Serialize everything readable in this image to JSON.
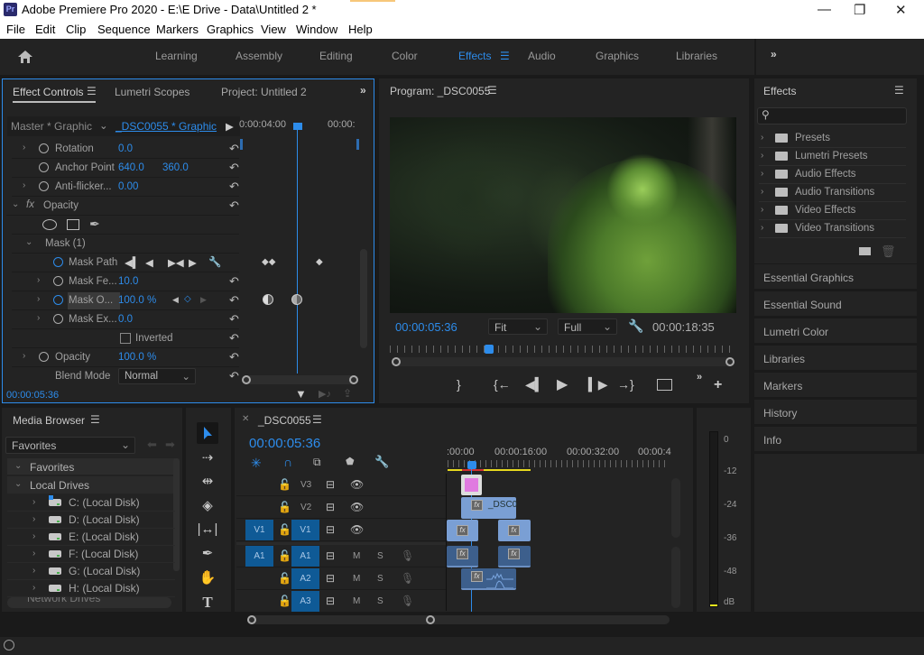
{
  "window": {
    "app_badge": "Pr",
    "title": "Adobe Premiere Pro 2020 - E:\\E Drive - Data\\Untitled 2 *",
    "controls": {
      "minimize": "—",
      "restore": "❐",
      "close": "✕"
    }
  },
  "menu": [
    "File",
    "Edit",
    "Clip",
    "Sequence",
    "Markers",
    "Graphics",
    "View",
    "Window",
    "Help"
  ],
  "workspaces": {
    "items": [
      "Learning",
      "Assembly",
      "Editing",
      "Color",
      "Effects",
      "Audio",
      "Graphics",
      "Libraries"
    ],
    "active": "Effects",
    "overflow": "»"
  },
  "effect_controls": {
    "tabs": [
      "Effect Controls",
      "Lumetri Scopes",
      "Project: Untitled 2"
    ],
    "active_tab": "Effect Controls",
    "master_label": "Master * Graphic",
    "clip_label": "_DSC0055 * Graphic",
    "ruler_start": "0:00:04:00",
    "ruler_end": "00:00:",
    "properties": {
      "rotation": {
        "label": "Rotation",
        "value": "0.0"
      },
      "anchor_point": {
        "label": "Anchor Point",
        "x": "640.0",
        "y": "360.0"
      },
      "anti_flicker": {
        "label": "Anti-flicker...",
        "value": "0.00"
      },
      "opacity_group": {
        "label": "Opacity",
        "fx": "fx"
      },
      "mask": {
        "label": "Mask (1)"
      },
      "mask_path": {
        "label": "Mask Path"
      },
      "mask_feather": {
        "label": "Mask Fe...",
        "value": "10.0"
      },
      "mask_opacity": {
        "label": "Mask O...",
        "value": "100.0 %"
      },
      "mask_expansion": {
        "label": "Mask Ex...",
        "value": "0.0"
      },
      "inverted": {
        "label": "Inverted",
        "checked": false
      },
      "opacity": {
        "label": "Opacity",
        "value": "100.0 %"
      },
      "blend_mode": {
        "label": "Blend Mode",
        "value": "Normal"
      }
    },
    "timecode": "00:00:05:36"
  },
  "program_monitor": {
    "title": "Program: _DSC0055",
    "timecode": "00:00:05:36",
    "zoom": "Fit",
    "resolution": "Full",
    "duration": "00:00:18:35",
    "playhead_fraction": 0.29
  },
  "effects_panel": {
    "title": "Effects",
    "search_placeholder": "",
    "items": [
      "Presets",
      "Lumetri Presets",
      "Audio Effects",
      "Audio Transitions",
      "Video Effects",
      "Video Transitions"
    ]
  },
  "side_panels": [
    "Essential Graphics",
    "Essential Sound",
    "Lumetri Color",
    "Libraries",
    "Markers",
    "History",
    "Info"
  ],
  "media_browser": {
    "title": "Media Browser",
    "location": "Favorites",
    "groups": [
      "Favorites",
      "Local Drives"
    ],
    "drives": [
      "C: (Local Disk)",
      "D: (Local Disk)",
      "E: (Local Disk)",
      "F: (Local Disk)",
      "G: (Local Disk)",
      "H: (Local Disk)"
    ],
    "partial": "Network Drives"
  },
  "timeline": {
    "sequence": "_DSC0055",
    "timecode": "00:00:05:36",
    "ruler": [
      ":00:00",
      "00:00:16:00",
      "00:00:32:00",
      "00:00:4"
    ],
    "video_tracks": [
      {
        "name": "V3",
        "source": ""
      },
      {
        "name": "V2",
        "source": ""
      },
      {
        "name": "V1",
        "source": "V1"
      }
    ],
    "audio_tracks": [
      {
        "name": "A1",
        "source": "A1",
        "m": "M",
        "s": "S"
      },
      {
        "name": "A2",
        "source": "",
        "m": "M",
        "s": "S"
      },
      {
        "name": "A3",
        "source": "",
        "m": "M",
        "s": "S"
      }
    ],
    "clip_label": "_DSC0"
  },
  "audio_meter": {
    "ticks": [
      "0",
      "-12",
      "-24",
      "-36",
      "-48",
      "dB"
    ]
  }
}
